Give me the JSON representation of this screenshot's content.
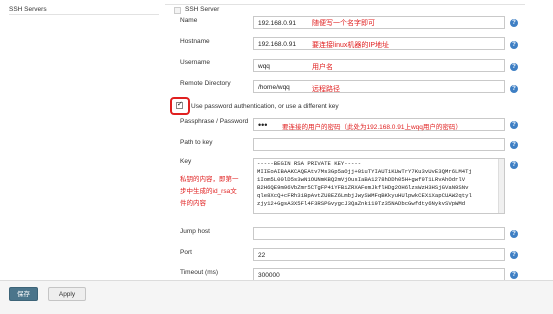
{
  "section": {
    "title": "SSH Servers",
    "group_title": "SSH Server"
  },
  "fields": {
    "hostname_name": {
      "label": "Name",
      "value": "192.168.0.91",
      "note": "随便写一个名字即可"
    },
    "hostname": {
      "label": "Hostname",
      "value": "192.168.0.91",
      "note": "要连接linux机器的IP地址"
    },
    "username": {
      "label": "Username",
      "value": "wqq",
      "note": "用户名"
    },
    "remote_dir": {
      "label": "Remote Directory",
      "value": "/home/wqq",
      "note": "远程路径"
    },
    "use_password": {
      "label": "Use password authentication, or use a different key",
      "checked": true
    },
    "passphrase": {
      "label": "Passphrase / Password",
      "value": "•••",
      "note": "要连接的用户的密码（此处为192.168.0.91上wqq用户的密码）"
    },
    "path_to_key": {
      "label": "Path to key",
      "value": ""
    },
    "key": {
      "label": "Key",
      "note": "私钥的内容，即第一步中生成的id_rsa文件的内容",
      "note_lines": [
        "私钥的内容，即第一",
        "步中生成的id_rsa文",
        "件的内容"
      ],
      "lines": [
        "-----BEGIN RSA PRIVATE KEY-----",
        "MIIEoAIBAAKCAQEAtv7Ms3Gp5aOjj+01uTYIAUTiKUwTrY7Ku3vUvE3QMr6LM4Tj",
        "1Iom5L00lD5s3wN1OUNmKBQ2mVjOusIaBA1278hDDh05H+gwf9T1LRvAhOdrlV",
        "B2H6QE9m96VbZmr5CTgFP41YFBiZRXAFemJkflHDg2OH6lzsWzH3HSjGVaN9SNv",
        "qle8XcQ+cFRh3iBpAvtZU8EZ6LmbjJwySWMFqBKkyuHUlpwkCEXiXapCUAW2qtyl",
        "zjy12+GgsA3X5Fl4F3RSPGvygcJ3QaZnk119Tz35NADbcGwfdty6NykvSVpWMd"
      ]
    },
    "jump_host": {
      "label": "Jump host",
      "value": ""
    },
    "port": {
      "label": "Port",
      "value": "22"
    },
    "timeout": {
      "label": "Timeout (ms)",
      "value": "300000"
    }
  },
  "help_icon": "?",
  "buttons": {
    "save": "保存",
    "apply": "Apply"
  }
}
